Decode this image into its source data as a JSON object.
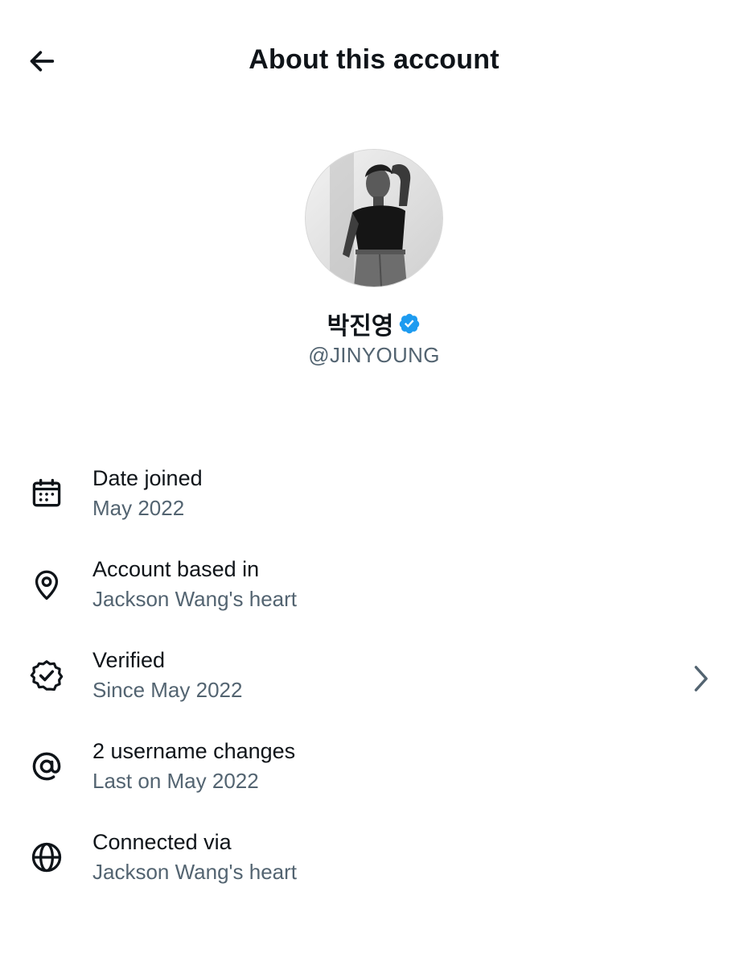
{
  "header": {
    "title": "About this account",
    "back_icon": "arrow-left-icon"
  },
  "profile": {
    "display_name": "박진영",
    "handle": "@JINYOUNG",
    "verified_badge_color": "#1d9bf0"
  },
  "info_items": [
    {
      "icon": "calendar-icon",
      "label": "Date joined",
      "value": "May 2022"
    },
    {
      "icon": "location-pin-icon",
      "label": "Account based in",
      "value": "Jackson Wang's heart"
    },
    {
      "icon": "verified-badge-icon",
      "label": "Verified",
      "value": "Since May 2022",
      "has_chevron": true
    },
    {
      "icon": "at-sign-icon",
      "label": "2 username changes",
      "value": "Last on May 2022"
    },
    {
      "icon": "globe-icon",
      "label": "Connected via",
      "value": "Jackson Wang's heart"
    }
  ],
  "colors": {
    "primary_text": "#0f1419",
    "secondary_text": "#536471",
    "accent": "#1d9bf0"
  }
}
